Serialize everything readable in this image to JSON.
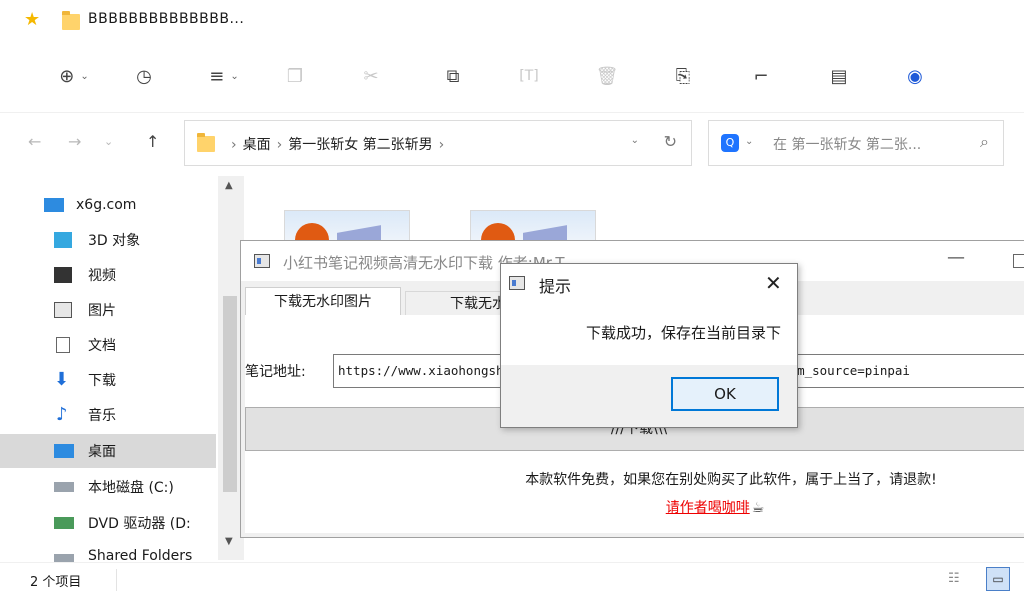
{
  "window": {
    "title": "BBBBBBBBBBBBBB..."
  },
  "toolbar": {
    "icons": [
      "new-icon",
      "history-icon",
      "view-menu-icon",
      "copy-icon",
      "cut-icon",
      "copy-to-icon",
      "rename-icon",
      "delete-icon",
      "share-icon",
      "crop-icon",
      "properties-icon",
      "app-icon"
    ]
  },
  "address": {
    "crumbs": [
      "桌面",
      "第一张斩女 第二张斩男"
    ],
    "search_placeholder": "在 第一张斩女 第二张..."
  },
  "nav": {
    "items": [
      {
        "label": "x6g.com",
        "icon": "computer-icon"
      },
      {
        "label": "3D 对象",
        "icon": "cube-icon"
      },
      {
        "label": "视频",
        "icon": "video-icon"
      },
      {
        "label": "图片",
        "icon": "pictures-icon"
      },
      {
        "label": "文档",
        "icon": "document-icon"
      },
      {
        "label": "下载",
        "icon": "download-icon"
      },
      {
        "label": "音乐",
        "icon": "music-icon"
      },
      {
        "label": "桌面",
        "icon": "desktop-icon",
        "selected": true
      },
      {
        "label": "本地磁盘 (C:)",
        "icon": "drive-icon"
      },
      {
        "label": "DVD 驱动器 (D:",
        "icon": "dvd-icon"
      },
      {
        "label": "Shared Folders",
        "icon": "network-icon"
      }
    ]
  },
  "status": {
    "count": "2 个项目"
  },
  "app": {
    "title": "小红书笔记视频高清无水印下载 作者:Mr.T",
    "tabs": [
      "下载无水印图片",
      "下载无水印"
    ],
    "note_label": "笔记地址:",
    "url": "https://www.xiaohongshu.com/explore/6362b06000000000270291a8?m_source=pinpai",
    "download_button": "///下载\\\\\\",
    "notice": "本款软件免费，如果您在别处购买了此软件，属于上当了，请退款!",
    "coffee_link": "请作者喝咖啡"
  },
  "dialog": {
    "title": "提示",
    "message": "下载成功，保存在当前目录下",
    "ok": "OK"
  }
}
